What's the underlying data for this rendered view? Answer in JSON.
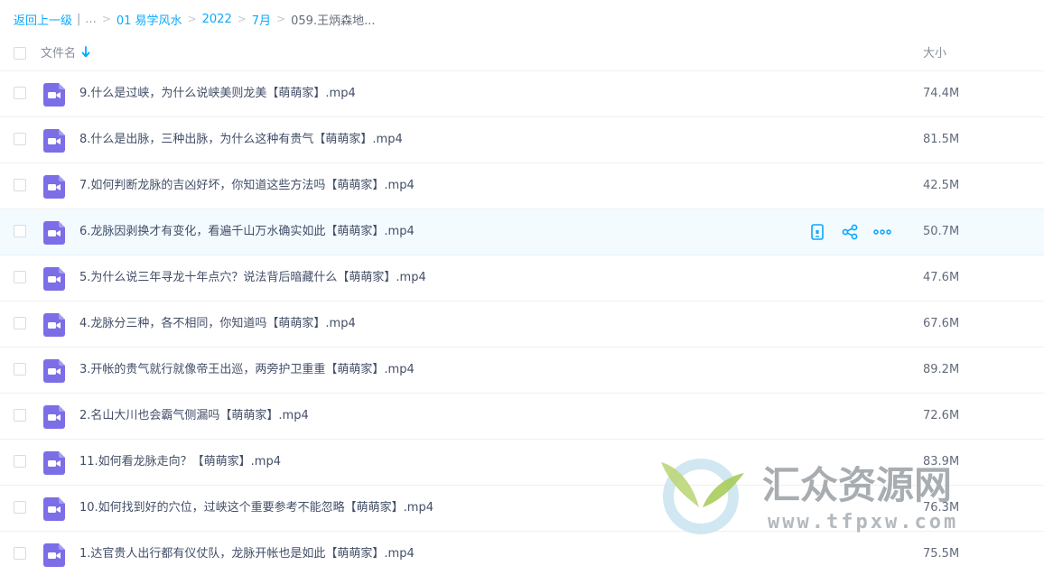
{
  "breadcrumb": {
    "back_label": "返回上一级",
    "ellipsis": "...",
    "items": [
      "01 易学风水",
      "2022",
      "7月"
    ],
    "current": "059.王炳森地..."
  },
  "header": {
    "name_label": "文件名",
    "size_label": "大小"
  },
  "files": [
    {
      "name": "9.什么是过峡，为什么说峡美则龙美【萌萌家】.mp4",
      "size": "74.4M"
    },
    {
      "name": "8.什么是出脉，三种出脉，为什么这种有贵气【萌萌家】.mp4",
      "size": "81.5M"
    },
    {
      "name": "7.如何判断龙脉的吉凶好坏，你知道这些方法吗【萌萌家】.mp4",
      "size": "42.5M"
    },
    {
      "name": "6.龙脉因剥换才有变化，看遍千山万水确实如此【萌萌家】.mp4",
      "size": "50.7M"
    },
    {
      "name": "5.为什么说三年寻龙十年点穴？说法背后暗藏什么【萌萌家】.mp4",
      "size": "47.6M"
    },
    {
      "name": "4.龙脉分三种，各不相同，你知道吗【萌萌家】.mp4",
      "size": "67.6M"
    },
    {
      "name": "3.开帐的贵气就行就像帝王出巡，两旁护卫重重【萌萌家】.mp4",
      "size": "89.2M"
    },
    {
      "name": "2.名山大川也会霸气侧漏吗【萌萌家】.mp4",
      "size": "72.6M"
    },
    {
      "name": "11.如何看龙脉走向？【萌萌家】.mp4",
      "size": "83.9M"
    },
    {
      "name": "10.如何找到好的穴位，过峡这个重要参考不能忽略【萌萌家】.mp4",
      "size": "76.3M"
    },
    {
      "name": "1.达官贵人出行都有仪仗队，龙脉开帐也是如此【萌萌家】.mp4",
      "size": "75.5M"
    }
  ],
  "hover_row_index": 3,
  "icons": {
    "file": "video-file-icon",
    "sort": "sort-down-arrow-icon",
    "actions": [
      "phone-icon",
      "share-icon",
      "more-icon"
    ]
  },
  "watermark": {
    "title": "汇众资源网",
    "url": "www.tfpxw.com"
  },
  "colors": {
    "accent": "#06a7ff",
    "file_icon": "#7b6ee6",
    "hover_row": "#f4fbff"
  }
}
